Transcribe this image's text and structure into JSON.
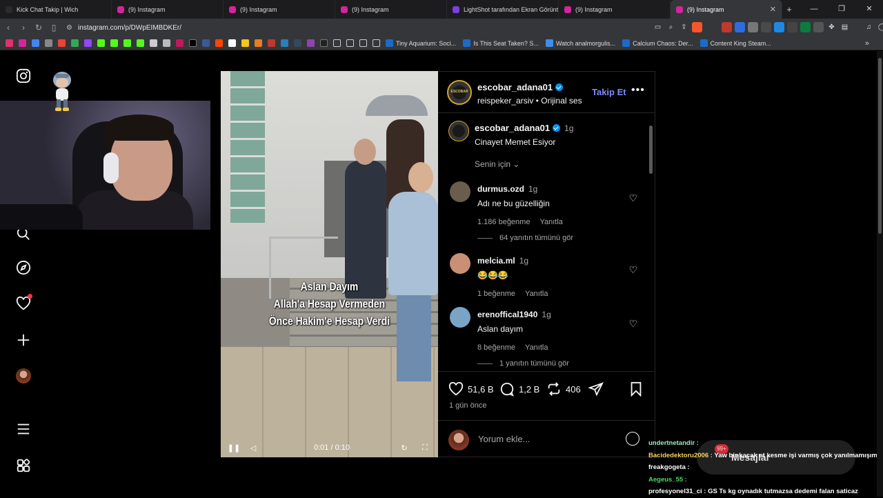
{
  "browser": {
    "tabs": [
      {
        "title": "Kick Chat Takip | Wich",
        "color": "#2b2b2b"
      },
      {
        "title": "(9) Instagram",
        "color": "#d6249f"
      },
      {
        "title": "(9) Instagram",
        "color": "#d6249f"
      },
      {
        "title": "(9) Instagram",
        "color": "#d6249f"
      },
      {
        "title": "LightShot tarafından Ekran Görüntüsü",
        "color": "#7b3fe4"
      },
      {
        "title": "(9) Instagram",
        "color": "#d6249f"
      },
      {
        "title": "(9) Instagram",
        "color": "#d6249f",
        "active": true
      }
    ],
    "url": "instagram.com/p/DWpEIMBDKEr/",
    "bookmarks": [
      {
        "label": "Tiny Aquarium: Soci...",
        "color": "#1b6ac9"
      },
      {
        "label": "Is This Seat Taken? S...",
        "color": "#1b6ac9"
      },
      {
        "label": "Watch analmorgulis...",
        "color": "#3d8ef0"
      },
      {
        "label": "Calcium Chaos: Der...",
        "color": "#1b6ac9"
      },
      {
        "label": "Content King Steam...",
        "color": "#1b6ac9"
      }
    ]
  },
  "post": {
    "author": "escobar_adana01",
    "author_avatar_text": "ESCOBAR",
    "audio": "reispeker_arsiv • Orijinal ses",
    "follow_label": "Takip Et",
    "caption": {
      "user": "escobar_adana01",
      "time": "1g",
      "text": "Cinayet Memet Esiyor"
    },
    "sort_label": "Senin için",
    "video_caption": [
      "Aslan Dayım",
      "Allah'a Hesap Vermeden",
      "Önce Hakim'e Hesap Verdi"
    ],
    "video_time": "0:01 / 0:10",
    "comments": [
      {
        "user": "durmus.ozd",
        "time": "1g",
        "text": "Adı ne bu güzelliğin",
        "likes": "1.186 beğenme",
        "reply": "Yanıtla",
        "replies": "64 yanıtın tümünü gör",
        "avatar_color": "#6b5d4e"
      },
      {
        "user": "melcia.ml",
        "time": "1g",
        "text": "😂😂😂",
        "likes": "1 beğenme",
        "reply": "Yanıtla",
        "replies": "",
        "avatar_color": "#c99075"
      },
      {
        "user": "erenoffical1940",
        "time": "1g",
        "text": "Aslan dayım",
        "likes": "8 beğenme",
        "reply": "Yanıtla",
        "replies": "1 yanıtın tümünü gör",
        "avatar_color": "#7aa4c6"
      }
    ],
    "likes": "51,6 B",
    "comment_count": "1,2 B",
    "reposts": "406",
    "date": "1 gün önce",
    "comment_placeholder": "Yorum ekle..."
  },
  "chat": [
    {
      "user": "undertnetandir :",
      "text": "",
      "color": "#9ee6c4"
    },
    {
      "user": "Bacidedektoru2006 :",
      "text": "Yaw bir kaçak et kesme işi varmış çok yanılmamışım",
      "color": "#f4d35e"
    },
    {
      "user": "freakgogeta :",
      "text": "",
      "color": "#ffffff"
    },
    {
      "user": "Aegeus_55 :",
      "text": "",
      "color": "#4cd964"
    },
    {
      "user": "profesyonel31_ci :",
      "text": "GS Ts kg oynadık tutmazsa dedemi falan saticaz",
      "color": "#ffffff"
    }
  ],
  "messages_pill": {
    "label": "Mesajlar",
    "badge": "99+"
  }
}
